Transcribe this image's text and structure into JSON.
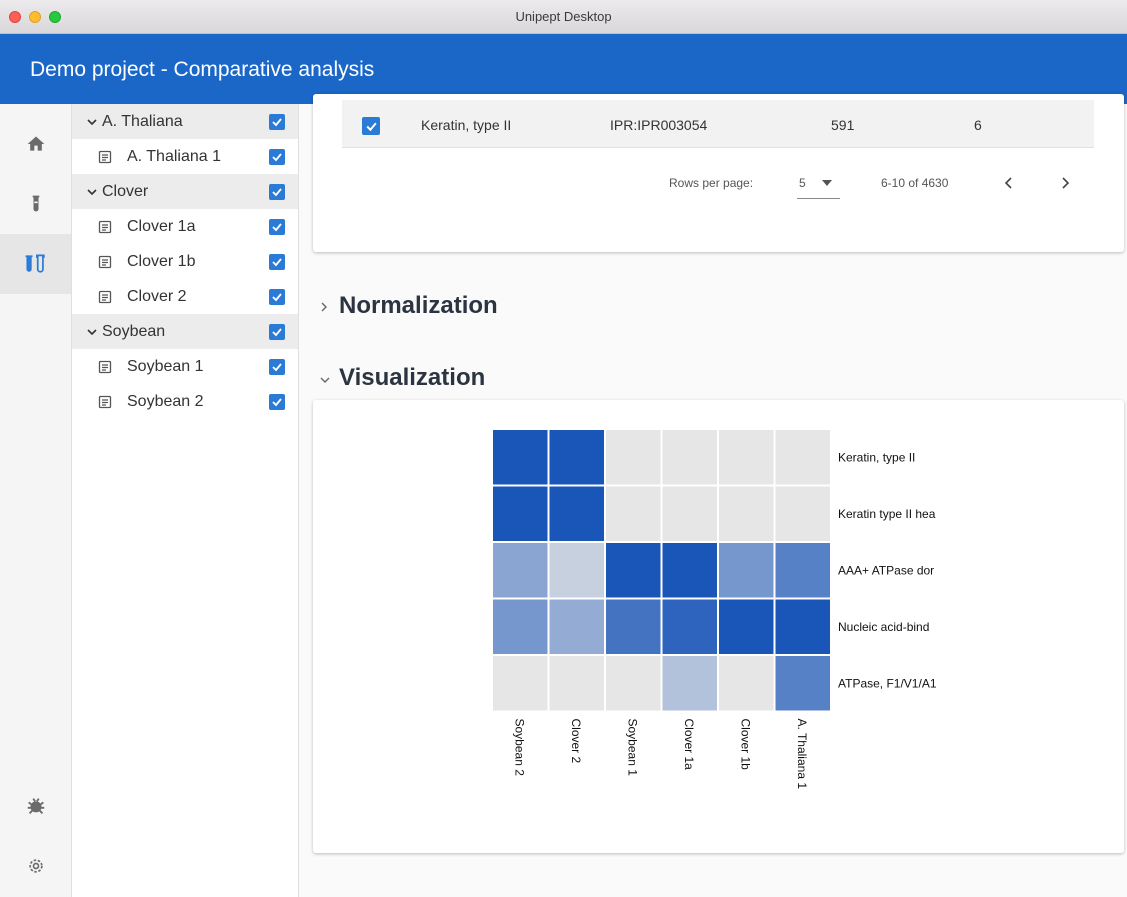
{
  "window": {
    "title": "Unipept Desktop"
  },
  "appbar": {
    "title": "Demo project - Comparative analysis"
  },
  "rail": {
    "items": [
      {
        "icon": "home-icon"
      },
      {
        "icon": "test-tube-icon"
      },
      {
        "icon": "compare-tubes-icon"
      },
      {
        "icon": "bug-icon"
      },
      {
        "icon": "gear-icon"
      }
    ]
  },
  "tree": {
    "items": [
      {
        "label": "A. Thaliana",
        "type": "group",
        "checked": true
      },
      {
        "label": "A. Thaliana 1",
        "type": "assay",
        "checked": true
      },
      {
        "label": "Clover",
        "type": "group",
        "checked": true
      },
      {
        "label": "Clover 1a",
        "type": "assay",
        "checked": true
      },
      {
        "label": "Clover 1b",
        "type": "assay",
        "checked": true
      },
      {
        "label": "Clover 2",
        "type": "assay",
        "checked": true
      },
      {
        "label": "Soybean",
        "type": "group",
        "checked": true
      },
      {
        "label": "Soybean 1",
        "type": "assay",
        "checked": true
      },
      {
        "label": "Soybean 2",
        "type": "assay",
        "checked": true
      }
    ]
  },
  "table": {
    "row": {
      "name": "Keratin, type II",
      "code": "IPR:IPR003054",
      "count": "591",
      "assays": "6",
      "checked": true
    },
    "pager": {
      "rows_label": "Rows per page:",
      "rows_value": "5",
      "range": "6-10 of 4630"
    }
  },
  "sections": {
    "normalization": "Normalization",
    "visualization": "Visualization"
  },
  "chart_data": {
    "type": "heatmap",
    "columns": [
      "Soybean 2",
      "Clover 2",
      "Soybean 1",
      "Clover 1a",
      "Clover 1b",
      "A. Thaliana 1"
    ],
    "rows": [
      "Keratin, type II",
      "Keratin type II hea",
      "AAA+ ATPase dor",
      "Nucleic acid-bind",
      "ATPase, F1/V1/A1"
    ],
    "values": [
      [
        1.0,
        1.0,
        0.0,
        0.0,
        0.0,
        0.0
      ],
      [
        1.0,
        1.0,
        0.0,
        0.0,
        0.0,
        0.0
      ],
      [
        0.45,
        0.15,
        1.0,
        1.0,
        0.55,
        0.7
      ],
      [
        0.55,
        0.4,
        0.8,
        0.9,
        1.0,
        1.0
      ],
      [
        0.0,
        0.0,
        0.0,
        0.25,
        0.0,
        0.7
      ]
    ],
    "color_low": "#e6e6e6",
    "color_high": "#1a56b8"
  }
}
